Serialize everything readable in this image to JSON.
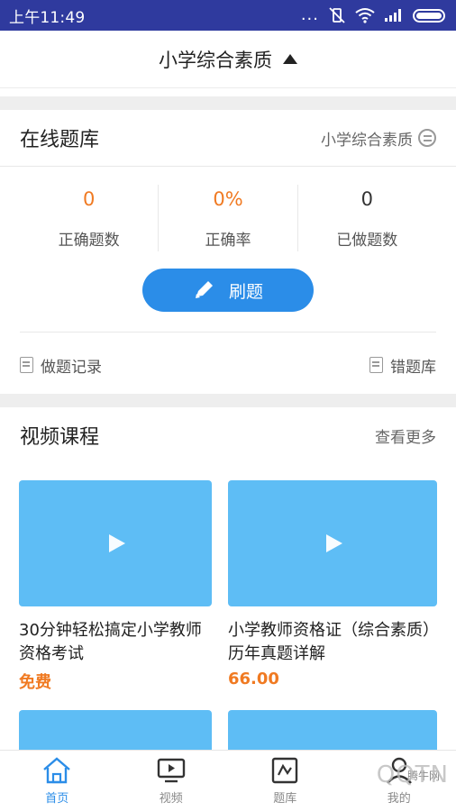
{
  "status_bar": {
    "time": "上午11:49",
    "dots": "..."
  },
  "header": {
    "title": "小学综合素质"
  },
  "bank": {
    "title": "在线题库",
    "subject_link": "小学综合素质",
    "stats": [
      {
        "value": "0",
        "label": "正确题数",
        "color": "#f07a22"
      },
      {
        "value": "0%",
        "label": "正确率",
        "color": "#f07a22"
      },
      {
        "value": "0",
        "label": "已做题数",
        "color": "#333333"
      }
    ],
    "practice_button": "刷题",
    "record_link": "做题记录",
    "wrong_bank_link": "错题库"
  },
  "videos": {
    "title": "视频课程",
    "more_link": "查看更多",
    "courses": [
      {
        "title": "30分钟轻松搞定小学教师资格考试",
        "price": "免费"
      },
      {
        "title": "小学教师资格证（综合素质）历年真题详解",
        "price": "66.00"
      }
    ]
  },
  "tabbar": {
    "items": [
      {
        "label": "首页",
        "icon": "home-icon",
        "active": true
      },
      {
        "label": "视频",
        "icon": "video-icon",
        "active": false
      },
      {
        "label": "题库",
        "icon": "bank-icon",
        "active": false
      },
      {
        "label": "我的",
        "icon": "user-icon",
        "active": false
      }
    ]
  },
  "watermark": {
    "text": "QQTN",
    "small": "腾牛网"
  },
  "colors": {
    "accent": "#2b8de8",
    "orange": "#f07a22",
    "status_bar": "#2f3a9e",
    "thumb": "#5ebdf5"
  }
}
